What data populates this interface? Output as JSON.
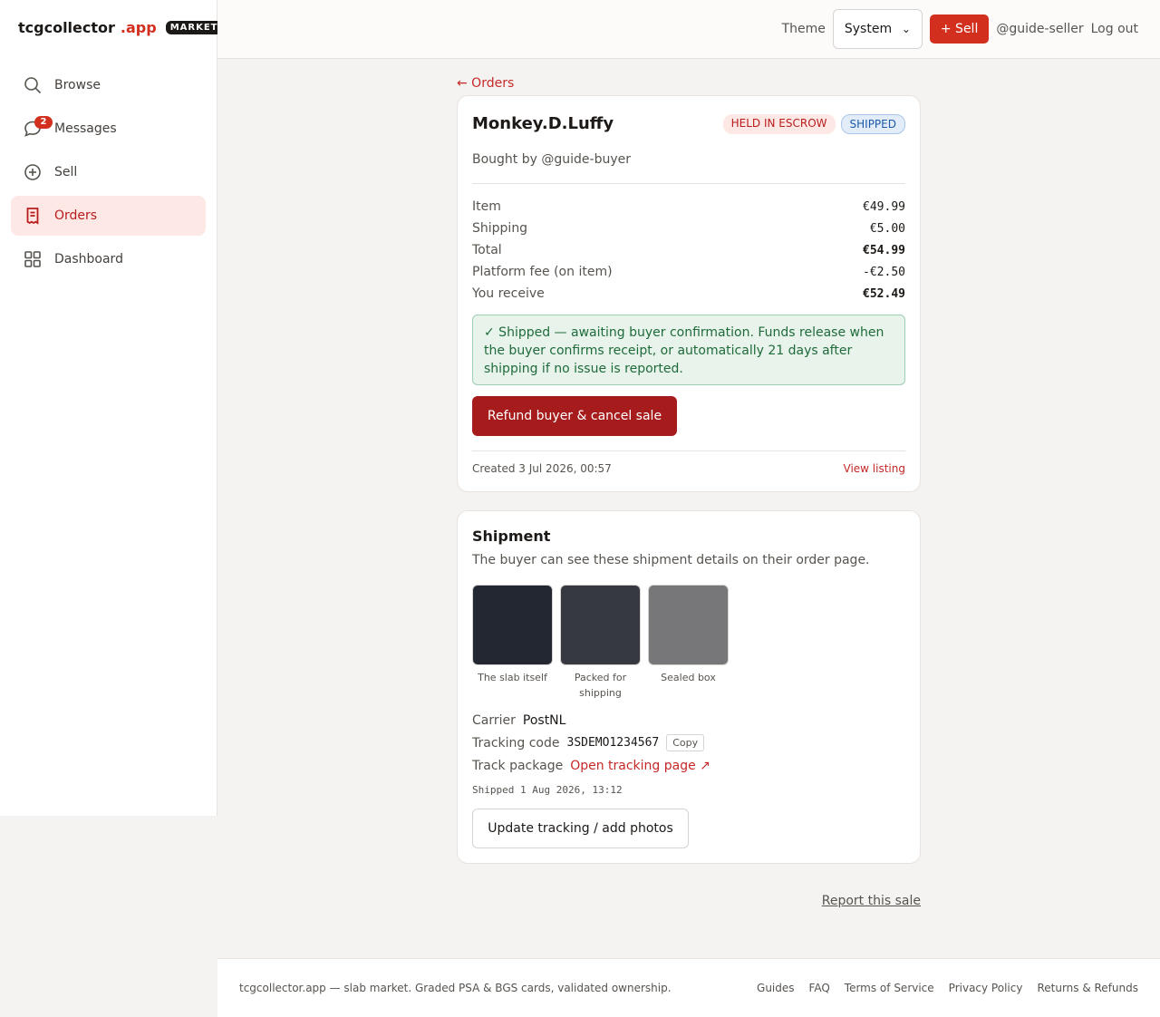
{
  "brand": {
    "name": "tcgcollector",
    "tld": ".app",
    "badge": "MARKET"
  },
  "sidebar": {
    "items": [
      {
        "label": "Browse",
        "icon": "search-icon"
      },
      {
        "label": "Messages",
        "icon": "chat-bubble-icon",
        "badge": "2"
      },
      {
        "label": "Sell",
        "icon": "plus-circle-icon"
      },
      {
        "label": "Orders",
        "icon": "receipt-icon",
        "active": true
      },
      {
        "label": "Dashboard",
        "icon": "grid-icon"
      }
    ]
  },
  "header": {
    "theme_label": "Theme",
    "theme_value": "System",
    "sell_label": "+ Sell",
    "user": "@guide-seller",
    "logout": "Log out"
  },
  "order": {
    "back_label": "← Orders",
    "title": "Monkey.D.Luffy",
    "status_escrow": "HELD IN ESCROW",
    "status_shipped": "SHIPPED",
    "buyer": "Bought by @guide-buyer",
    "prices": [
      {
        "label": "Item",
        "value": "€49.99"
      },
      {
        "label": "Shipping",
        "value": "€5.00"
      },
      {
        "label": "Total",
        "value": "€54.99"
      },
      {
        "label": "Platform fee (on item)",
        "value": "-€2.50"
      },
      {
        "label": "You receive",
        "value": "€52.49"
      }
    ],
    "notice": "✓ Shipped — awaiting buyer confirmation. Funds release when the buyer confirms receipt, or automatically 21 days after shipping if no issue is reported.",
    "refund_label": "Refund buyer & cancel sale",
    "created": "Created 3 Jul 2026, 00:57",
    "view_listing": "View listing"
  },
  "shipment": {
    "title": "Shipment",
    "subtitle": "The buyer can see these shipment details on their order page.",
    "photos": [
      {
        "caption": "The slab itself",
        "color": "#222731"
      },
      {
        "caption": "Packed for shipping",
        "color": "#363940"
      },
      {
        "caption": "Sealed box",
        "color": "#77777a"
      }
    ],
    "carrier_label": "Carrier",
    "carrier": "PostNL",
    "tracking_label": "Tracking code",
    "tracking_code": "3SDEMO1234567",
    "copy_label": "Copy",
    "track_label": "Track package",
    "track_link": "Open tracking page ↗",
    "shipped_at": "Shipped 1 Aug 2026, 13:12",
    "update_label": "Update tracking / add photos"
  },
  "report_label": "Report this sale",
  "footer": {
    "text": "tcgcollector.app — slab market. Graded PSA & BGS cards, validated ownership.",
    "links": [
      "Guides",
      "FAQ",
      "Terms of Service",
      "Privacy Policy",
      "Returns & Refunds"
    ]
  },
  "colors": {
    "accent": "#d32f1e",
    "danger": "#a61b1b",
    "success_bg": "#e8f3ec",
    "success_text": "#1f6b3a"
  }
}
